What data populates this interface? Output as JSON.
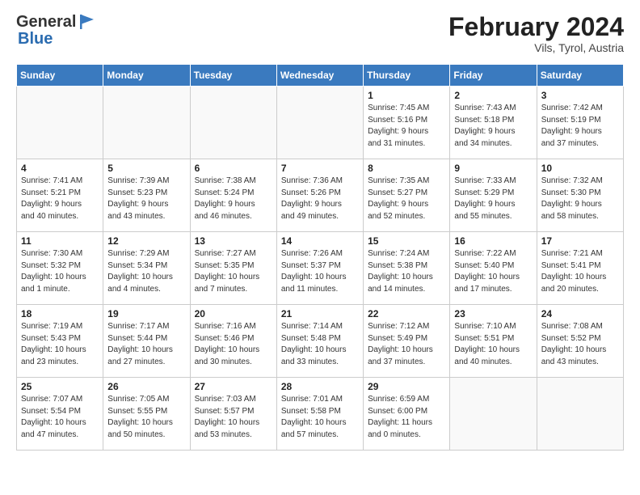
{
  "header": {
    "logo_general": "General",
    "logo_blue": "Blue",
    "title": "February 2024",
    "subtitle": "Vils, Tyrol, Austria"
  },
  "weekdays": [
    "Sunday",
    "Monday",
    "Tuesday",
    "Wednesday",
    "Thursday",
    "Friday",
    "Saturday"
  ],
  "weeks": [
    [
      {
        "day": "",
        "info": ""
      },
      {
        "day": "",
        "info": ""
      },
      {
        "day": "",
        "info": ""
      },
      {
        "day": "",
        "info": ""
      },
      {
        "day": "1",
        "info": "Sunrise: 7:45 AM\nSunset: 5:16 PM\nDaylight: 9 hours\nand 31 minutes."
      },
      {
        "day": "2",
        "info": "Sunrise: 7:43 AM\nSunset: 5:18 PM\nDaylight: 9 hours\nand 34 minutes."
      },
      {
        "day": "3",
        "info": "Sunrise: 7:42 AM\nSunset: 5:19 PM\nDaylight: 9 hours\nand 37 minutes."
      }
    ],
    [
      {
        "day": "4",
        "info": "Sunrise: 7:41 AM\nSunset: 5:21 PM\nDaylight: 9 hours\nand 40 minutes."
      },
      {
        "day": "5",
        "info": "Sunrise: 7:39 AM\nSunset: 5:23 PM\nDaylight: 9 hours\nand 43 minutes."
      },
      {
        "day": "6",
        "info": "Sunrise: 7:38 AM\nSunset: 5:24 PM\nDaylight: 9 hours\nand 46 minutes."
      },
      {
        "day": "7",
        "info": "Sunrise: 7:36 AM\nSunset: 5:26 PM\nDaylight: 9 hours\nand 49 minutes."
      },
      {
        "day": "8",
        "info": "Sunrise: 7:35 AM\nSunset: 5:27 PM\nDaylight: 9 hours\nand 52 minutes."
      },
      {
        "day": "9",
        "info": "Sunrise: 7:33 AM\nSunset: 5:29 PM\nDaylight: 9 hours\nand 55 minutes."
      },
      {
        "day": "10",
        "info": "Sunrise: 7:32 AM\nSunset: 5:30 PM\nDaylight: 9 hours\nand 58 minutes."
      }
    ],
    [
      {
        "day": "11",
        "info": "Sunrise: 7:30 AM\nSunset: 5:32 PM\nDaylight: 10 hours\nand 1 minute."
      },
      {
        "day": "12",
        "info": "Sunrise: 7:29 AM\nSunset: 5:34 PM\nDaylight: 10 hours\nand 4 minutes."
      },
      {
        "day": "13",
        "info": "Sunrise: 7:27 AM\nSunset: 5:35 PM\nDaylight: 10 hours\nand 7 minutes."
      },
      {
        "day": "14",
        "info": "Sunrise: 7:26 AM\nSunset: 5:37 PM\nDaylight: 10 hours\nand 11 minutes."
      },
      {
        "day": "15",
        "info": "Sunrise: 7:24 AM\nSunset: 5:38 PM\nDaylight: 10 hours\nand 14 minutes."
      },
      {
        "day": "16",
        "info": "Sunrise: 7:22 AM\nSunset: 5:40 PM\nDaylight: 10 hours\nand 17 minutes."
      },
      {
        "day": "17",
        "info": "Sunrise: 7:21 AM\nSunset: 5:41 PM\nDaylight: 10 hours\nand 20 minutes."
      }
    ],
    [
      {
        "day": "18",
        "info": "Sunrise: 7:19 AM\nSunset: 5:43 PM\nDaylight: 10 hours\nand 23 minutes."
      },
      {
        "day": "19",
        "info": "Sunrise: 7:17 AM\nSunset: 5:44 PM\nDaylight: 10 hours\nand 27 minutes."
      },
      {
        "day": "20",
        "info": "Sunrise: 7:16 AM\nSunset: 5:46 PM\nDaylight: 10 hours\nand 30 minutes."
      },
      {
        "day": "21",
        "info": "Sunrise: 7:14 AM\nSunset: 5:48 PM\nDaylight: 10 hours\nand 33 minutes."
      },
      {
        "day": "22",
        "info": "Sunrise: 7:12 AM\nSunset: 5:49 PM\nDaylight: 10 hours\nand 37 minutes."
      },
      {
        "day": "23",
        "info": "Sunrise: 7:10 AM\nSunset: 5:51 PM\nDaylight: 10 hours\nand 40 minutes."
      },
      {
        "day": "24",
        "info": "Sunrise: 7:08 AM\nSunset: 5:52 PM\nDaylight: 10 hours\nand 43 minutes."
      }
    ],
    [
      {
        "day": "25",
        "info": "Sunrise: 7:07 AM\nSunset: 5:54 PM\nDaylight: 10 hours\nand 47 minutes."
      },
      {
        "day": "26",
        "info": "Sunrise: 7:05 AM\nSunset: 5:55 PM\nDaylight: 10 hours\nand 50 minutes."
      },
      {
        "day": "27",
        "info": "Sunrise: 7:03 AM\nSunset: 5:57 PM\nDaylight: 10 hours\nand 53 minutes."
      },
      {
        "day": "28",
        "info": "Sunrise: 7:01 AM\nSunset: 5:58 PM\nDaylight: 10 hours\nand 57 minutes."
      },
      {
        "day": "29",
        "info": "Sunrise: 6:59 AM\nSunset: 6:00 PM\nDaylight: 11 hours\nand 0 minutes."
      },
      {
        "day": "",
        "info": ""
      },
      {
        "day": "",
        "info": ""
      }
    ]
  ]
}
